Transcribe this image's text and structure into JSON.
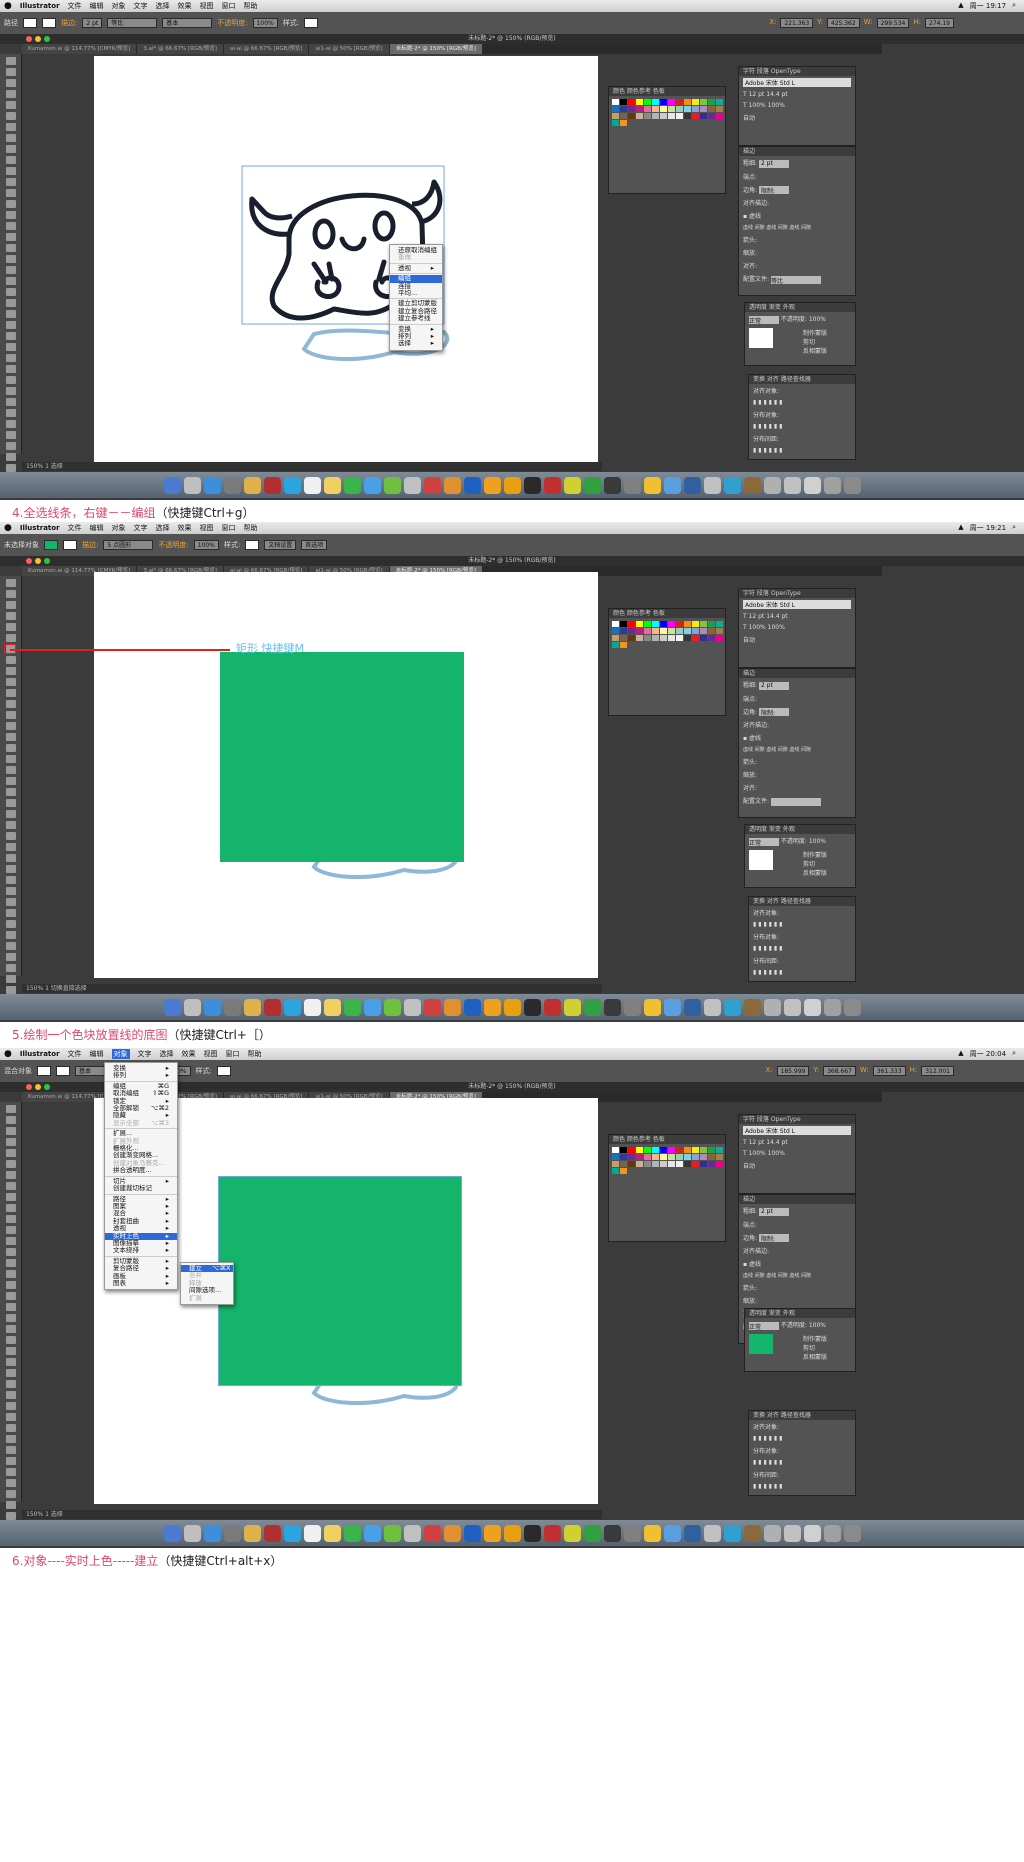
{
  "shots": [
    {
      "menubar": {
        "app": "Illustrator",
        "menus": [
          "文件",
          "编辑",
          "对象",
          "文字",
          "选择",
          "效果",
          "视图",
          "窗口",
          "帮助"
        ],
        "clock": "周一 19:17"
      },
      "control": {
        "mode": "路径",
        "stroke_label": "描边:",
        "weight": "2 pt",
        "line1": "等比",
        "line2": "基本",
        "opacity_label": "不透明度:",
        "opacity": "100%",
        "style_label": "样式:",
        "x": "221.363",
        "y": "425.362",
        "w": "299.534",
        "h": "274.19"
      },
      "title": "未标题-2* @ 150% (RGB/预览)",
      "tabs": [
        "Kumamon.ai @ 114.77% [CMYK/预览]",
        "3.ai* @ 66.67% [RGB/预览]",
        "ai-ai @ 66.67% [RGB/预览]",
        "ai1-ai @ 50% [RGB/预览]",
        "未标题-2* @ 150% [RGB/预览]"
      ],
      "status": {
        "zoom": "150%",
        "page": "1",
        "tool": "选择"
      },
      "context_menu": [
        {
          "label": "还原取消编组"
        },
        {
          "label": "重做",
          "dim": true
        },
        {
          "sep": true
        },
        {
          "label": "透视",
          "sub": true
        },
        {
          "sep": true
        },
        {
          "label": "编组",
          "hl": true
        },
        {
          "label": "连接"
        },
        {
          "label": "平均..."
        },
        {
          "sep": true
        },
        {
          "label": "建立剪切蒙版"
        },
        {
          "label": "建立复合路径"
        },
        {
          "label": "建立参考线"
        },
        {
          "sep": true
        },
        {
          "label": "变换",
          "sub": true
        },
        {
          "label": "排列",
          "sub": true
        },
        {
          "label": "选择",
          "sub": true
        }
      ],
      "caption": {
        "text": "4.全选线条，右键－－编组",
        "key": "（快捷键Ctrl+g）"
      }
    },
    {
      "menubar": {
        "app": "Illustrator",
        "menus": [
          "文件",
          "编辑",
          "对象",
          "文字",
          "选择",
          "效果",
          "视图",
          "窗口",
          "帮助"
        ],
        "clock": "周一 19:21"
      },
      "control": {
        "mode": "未选择对象",
        "stroke_label": "描边:",
        "weight": "",
        "line1": "",
        "line2": "5 点圆形",
        "opacity_label": "不透明度:",
        "opacity": "100%",
        "style_label": "样式:",
        "doc_setup": "文档设置",
        "prefs": "首选项"
      },
      "title": "未标题-2* @ 150% (RGB/预览)",
      "tabs": [
        "Kumamon.ai @ 114.77% [CMYK/预览]",
        "3.ai* @ 66.67% [RGB/预览]",
        "ai-ai @ 66.67% [RGB/预览]",
        "ai1-ai @ 50% [RGB/预览]",
        "未标题-2* @ 150% [RGB/预览]"
      ],
      "status": {
        "zoom": "150%",
        "page": "1",
        "tool": "切换直接选择"
      },
      "annotation": "矩形 快捷键M",
      "caption": {
        "text": "5.绘制一个色块放置线的底图",
        "key": "（快捷键Ctrl+［）"
      }
    },
    {
      "menubar": {
        "app": "Illustrator",
        "menus": [
          "文件",
          "编辑",
          "对象",
          "文字",
          "选择",
          "效果",
          "视图",
          "窗口",
          "帮助"
        ],
        "clock": "周一 20:04"
      },
      "control": {
        "mode": "混合对象",
        "stroke_label": "",
        "weight": "",
        "line1": "",
        "line2": "基本",
        "opacity_label": "不透明度:",
        "opacity": "100%",
        "style_label": "样式:",
        "x": "185.999",
        "y": "368.667",
        "w": "361.333",
        "h": "312.001"
      },
      "title": "未标题-2* @ 150% (RGB/预览)",
      "tabs": [
        "Kumamon.ai @ 114.77% [CMYK/预览]",
        "3.ai* @ 66.67% [RGB/预览]",
        "ai-ai @ 66.67% [RGB/预览]",
        "ai1-ai @ 50% [RGB/预览]",
        "未标题-2* @ 150% [RGB/预览]"
      ],
      "status": {
        "zoom": "150%",
        "page": "1",
        "tool": "选择"
      },
      "object_menu": [
        {
          "label": "变换",
          "sub": true
        },
        {
          "label": "排列",
          "sub": true
        },
        {
          "sep": true
        },
        {
          "label": "编组",
          "sc": "⌘G"
        },
        {
          "label": "取消编组",
          "sc": "⇧⌘G"
        },
        {
          "label": "锁定",
          "sub": true
        },
        {
          "label": "全部解锁",
          "sc": "⌥⌘2"
        },
        {
          "label": "隐藏",
          "sub": true
        },
        {
          "label": "显示全部",
          "sc": "⌥⌘3",
          "dim": true
        },
        {
          "sep": true
        },
        {
          "label": "扩展..."
        },
        {
          "label": "扩展外观",
          "dim": true
        },
        {
          "label": "栅格化..."
        },
        {
          "label": "创建渐变网格..."
        },
        {
          "label": "创建对象马赛克...",
          "dim": true
        },
        {
          "label": "拼合透明度..."
        },
        {
          "sep": true
        },
        {
          "label": "切片",
          "sub": true
        },
        {
          "label": "创建裁切标记"
        },
        {
          "sep": true
        },
        {
          "label": "路径",
          "sub": true
        },
        {
          "label": "图案",
          "sub": true
        },
        {
          "label": "混合",
          "sub": true
        },
        {
          "label": "封套扭曲",
          "sub": true
        },
        {
          "label": "透视",
          "sub": true
        },
        {
          "label": "实时上色",
          "sub": true,
          "hl": true
        },
        {
          "label": "图像描摹",
          "sub": true
        },
        {
          "label": "文本绕排",
          "sub": true
        },
        {
          "sep": true
        },
        {
          "label": "剪切蒙版",
          "sub": true
        },
        {
          "label": "复合路径",
          "sub": true
        },
        {
          "label": "画板",
          "sub": true
        },
        {
          "label": "图表",
          "sub": true
        }
      ],
      "submenu": [
        {
          "label": "建立",
          "sc": "⌥⌘X",
          "hl": true
        },
        {
          "label": "合并",
          "dim": true
        },
        {
          "label": "释放",
          "dim": true
        },
        {
          "label": "间隙选项..."
        },
        {
          "label": "扩展",
          "dim": true
        }
      ],
      "caption": {
        "text": "6.对象----实时上色-----建立",
        "key": "（快捷键Ctrl+alt+x）"
      }
    }
  ],
  "panels": {
    "swatch_tabs": [
      "颜色",
      "颜色参考",
      "色板"
    ],
    "char_tabs": [
      "字符",
      "段落",
      "OpenType"
    ],
    "font": "Adobe 宋体 Std L",
    "font_size": "12 pt",
    "leading": "14.4 pt",
    "scale_v": "100%",
    "scale_h": "100%",
    "tracking": "自动",
    "stroke": {
      "title": "描边",
      "weight_label": "粗细:",
      "weight": "2 pt",
      "cap_label": "端点:",
      "corner_label": "边角:",
      "limit_label": "限制:",
      "align_label": "对齐描边:",
      "dashed_label": "虚线",
      "dash_labels": [
        "虚线",
        "间隙",
        "虚线",
        "间隙",
        "虚线",
        "间隙"
      ],
      "arrow_label": "箭头:",
      "scale_label": "缩放:",
      "align2_label": "对齐:",
      "profile_label": "配置文件:",
      "profile": "等比"
    },
    "transparency": {
      "tabs": [
        "透明度",
        "渐变",
        "外观"
      ],
      "mode": "正常",
      "opacity_label": "不透明度:",
      "opacity": "100%",
      "make_mask": "制作蒙版",
      "clip": "剪切",
      "invert": "反相蒙版"
    },
    "align": {
      "tabs": [
        "变换",
        "对齐",
        "路径查找器"
      ],
      "align_objects": "对齐对象:",
      "distribute_objects": "分布对象:",
      "distribute_spacing": "分布间距:",
      "align_to": "对齐:"
    }
  },
  "colors": {
    "green": "#14b46a",
    "stroke": "#1a1f2e",
    "ghost_blue": "#8fb7d6",
    "caption_pink": "#e0466e"
  }
}
